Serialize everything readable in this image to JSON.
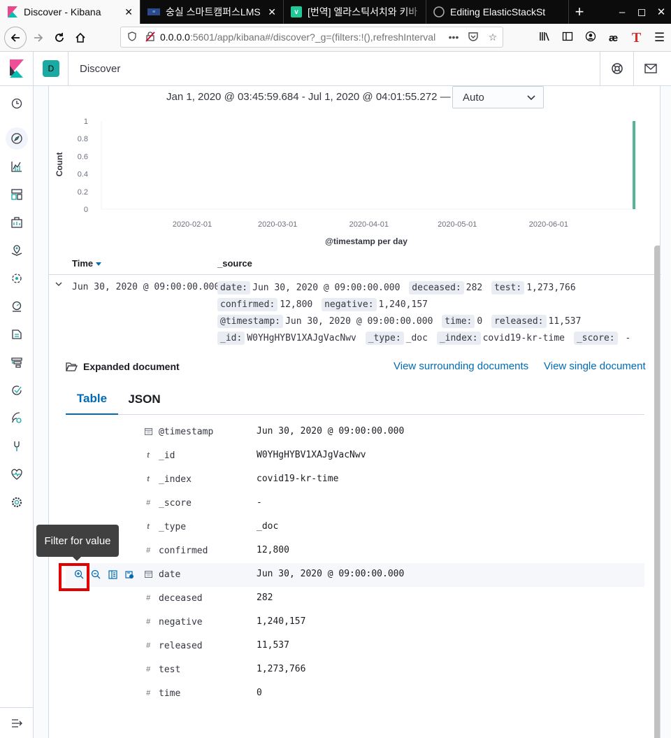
{
  "browser": {
    "tabs": [
      {
        "title": "Discover - Kibana",
        "active": true
      },
      {
        "title": "숭실 스마트캠퍼스LMS",
        "active": false
      },
      {
        "title": "[번역] 엘라스틱서치와 키바",
        "active": false
      },
      {
        "title": "Editing ElasticStackSt",
        "active": false
      }
    ],
    "url_host": "0.0.0.0",
    "url_rest": ":5601/app/kibana#/discover?_g=(filters:!(),refreshInterval",
    "url_more": "•••"
  },
  "kibana": {
    "space_initial": "D",
    "app_title": "Discover"
  },
  "histogram": {
    "time_range": "Jan 1, 2020 @ 03:45:59.684 - Jul 1, 2020 @ 04:01:55.272 —",
    "interval": "Auto"
  },
  "chart_data": {
    "type": "bar",
    "xlabel": "@timestamp per day",
    "ylabel": "Count",
    "ylim": [
      0,
      1
    ],
    "yticks": [
      "1",
      "0.8",
      "0.6",
      "0.4",
      "0.2",
      "0"
    ],
    "xticks": [
      "2020-02-01",
      "2020-03-01",
      "2020-04-01",
      "2020-05-01",
      "2020-06-01"
    ],
    "x": [
      "2020-06-30"
    ],
    "values": [
      1
    ],
    "bar_color": "#54b399"
  },
  "table": {
    "col_time": "Time",
    "col_source": "_source",
    "row_time": "Jun 30, 2020 @ 09:00:00.000",
    "source": [
      {
        "k": "date:",
        "v": "Jun 30, 2020 @ 09:00:00.000"
      },
      {
        "k": "deceased:",
        "v": "282"
      },
      {
        "k": "test:",
        "v": "1,273,766"
      },
      {
        "k": "confirmed:",
        "v": "12,800"
      },
      {
        "k": "negative:",
        "v": "1,240,157"
      },
      {
        "k": "@timestamp:",
        "v": "Jun 30, 2020 @ 09:00:00.000"
      },
      {
        "k": "time:",
        "v": "0"
      },
      {
        "k": "released:",
        "v": "11,537"
      },
      {
        "k": "_id:",
        "v": "W0YHgHYBV1XAJgVacNwv"
      },
      {
        "k": "_type:",
        "v": "_doc"
      },
      {
        "k": "_index:",
        "v": "covid19-kr-time"
      },
      {
        "k": "_score:",
        "v": " -"
      }
    ]
  },
  "expanded": {
    "title": "Expanded document",
    "link_surrounding": "View surrounding documents",
    "link_single": "View single document",
    "tab_table": "Table",
    "tab_json": "JSON",
    "fields": [
      {
        "type": "date",
        "name": "@timestamp",
        "value": "Jun 30, 2020 @ 09:00:00.000"
      },
      {
        "type": "t",
        "name": "_id",
        "value": "W0YHgHYBV1XAJgVacNwv"
      },
      {
        "type": "t",
        "name": "_index",
        "value": "covid19-kr-time"
      },
      {
        "type": "#",
        "name": "_score",
        "value": " -"
      },
      {
        "type": "t",
        "name": "_type",
        "value": "_doc"
      },
      {
        "type": "#",
        "name": "confirmed",
        "value": "12,800"
      },
      {
        "type": "date",
        "name": "date",
        "value": "Jun 30, 2020 @ 09:00:00.000"
      },
      {
        "type": "#",
        "name": "deceased",
        "value": "282"
      },
      {
        "type": "#",
        "name": "negative",
        "value": "1,240,157"
      },
      {
        "type": "#",
        "name": "released",
        "value": "11,537"
      },
      {
        "type": "#",
        "name": "test",
        "value": "1,273,766"
      },
      {
        "type": "#",
        "name": "time",
        "value": "0"
      }
    ],
    "tooltip": "Filter for value"
  }
}
